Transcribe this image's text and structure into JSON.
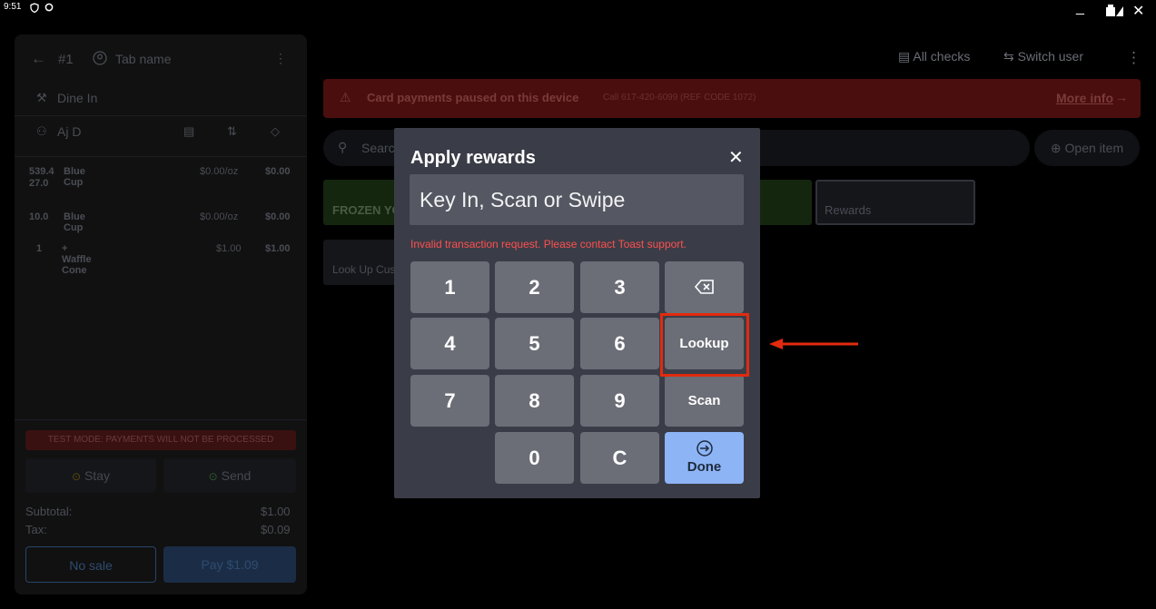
{
  "status_bar": {
    "time": "9:51"
  },
  "order_panel": {
    "check_number": "#1",
    "tab_name": "Tab name",
    "dining_option": "Dine In",
    "server": "Aj D",
    "items": [
      {
        "qty": "539.4 27.0",
        "name": "Blue Cup",
        "unit_price": "$0.00/oz",
        "total": "$0.00"
      },
      {
        "qty": "10.0",
        "name": "Blue Cup",
        "unit_price": "$0.00/oz",
        "total": "$0.00"
      },
      {
        "qty": "1",
        "name": "+ Waffle Cone",
        "unit_price": "$1.00",
        "total": "$1.00"
      }
    ],
    "test_mode_banner": "TEST MODE:  PAYMENTS WILL NOT BE PROCESSED",
    "stay_label": "Stay",
    "send_label": "Send",
    "subtotal_label": "Subtotal:",
    "subtotal_value": "$1.00",
    "tax_label": "Tax:",
    "tax_value": "$0.09",
    "no_sale_label": "No sale",
    "pay_label": "Pay $1.09"
  },
  "top_bar": {
    "all_checks_label": "All checks",
    "switch_user_label": "Switch user"
  },
  "alert": {
    "message": "Card payments paused on this device",
    "detail": "Call 617-420-6099 (REF CODE 1072)",
    "more_info": "More info"
  },
  "search": {
    "placeholder": "Search"
  },
  "open_item_label": "Open item",
  "menu_tiles": {
    "frozen": "FROZEN YOGURT",
    "rewards": "Rewards",
    "lookup": "Look Up Customer"
  },
  "modal": {
    "title": "Apply rewards",
    "input_placeholder": "Key In, Scan or Swipe",
    "error": "Invalid transaction request. Please contact Toast support.",
    "keys": {
      "k1": "1",
      "k2": "2",
      "k3": "3",
      "k4": "4",
      "k5": "5",
      "k6": "6",
      "k7": "7",
      "k8": "8",
      "k9": "9",
      "k0": "0",
      "clear": "C",
      "lookup": "Lookup",
      "scan": "Scan",
      "done": "Done"
    }
  },
  "colors": {
    "annotation": "#e22a0f",
    "done_button": "#8db4f5",
    "error_text": "#ff4f4f"
  }
}
